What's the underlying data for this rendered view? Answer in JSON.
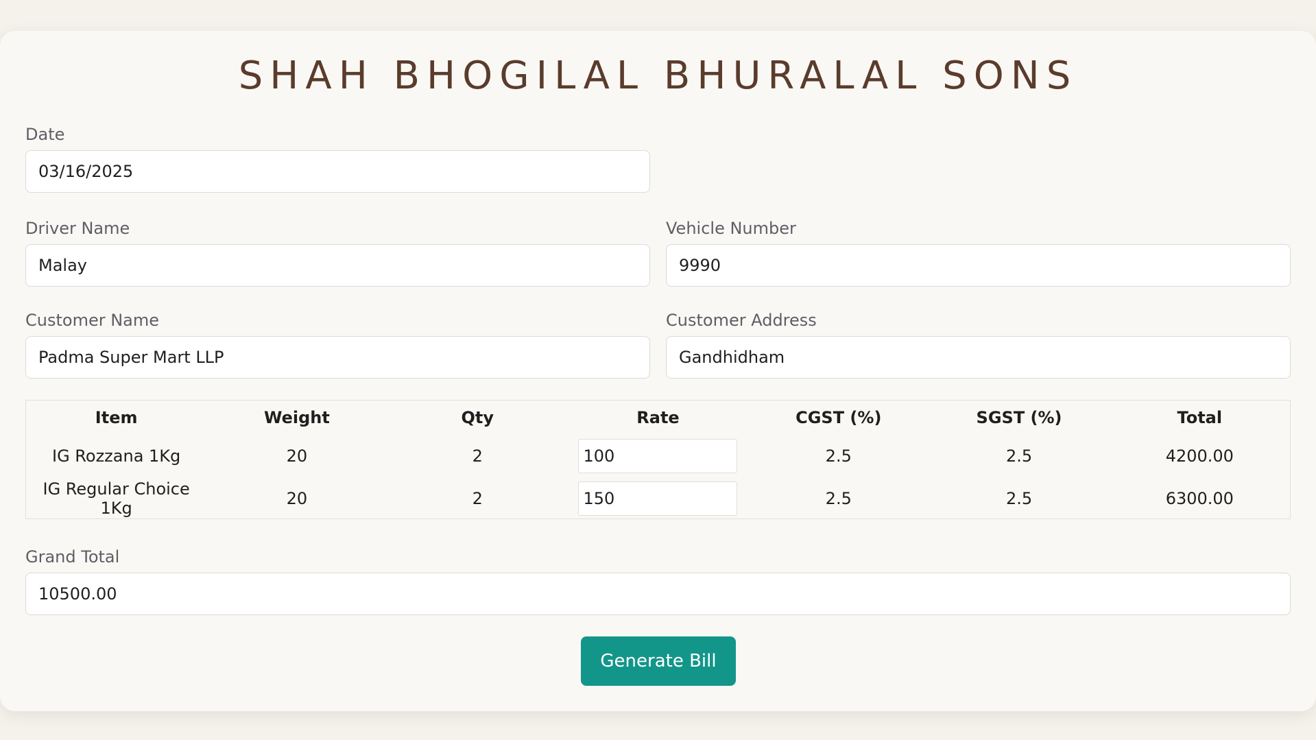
{
  "header": {
    "title": "SHAH BHOGILAL BHURALAL SONS"
  },
  "form": {
    "date": {
      "label": "Date",
      "value": "03/16/2025"
    },
    "driver": {
      "label": "Driver Name",
      "value": "Malay"
    },
    "vehicle": {
      "label": "Vehicle Number",
      "value": "9990"
    },
    "customer_name": {
      "label": "Customer Name",
      "value": "Padma Super Mart LLP"
    },
    "customer_address": {
      "label": "Customer Address",
      "value": "Gandhidham"
    }
  },
  "table": {
    "columns": [
      "Item",
      "Weight",
      "Qty",
      "Rate",
      "CGST (%)",
      "SGST (%)",
      "Total"
    ],
    "rows": [
      {
        "item": "IG Rozzana 1Kg",
        "weight": "20",
        "qty": "2",
        "rate": "100",
        "cgst": "2.5",
        "sgst": "2.5",
        "total": "4200.00"
      },
      {
        "item": "IG Regular Choice 1Kg",
        "weight": "20",
        "qty": "2",
        "rate": "150",
        "cgst": "2.5",
        "sgst": "2.5",
        "total": "6300.00"
      }
    ]
  },
  "grand_total": {
    "label": "Grand Total",
    "value": "10500.00"
  },
  "actions": {
    "generate_label": "Generate Bill"
  },
  "colors": {
    "accent": "#13968a",
    "title": "#5a3c2c",
    "background": "#faf8f4"
  }
}
